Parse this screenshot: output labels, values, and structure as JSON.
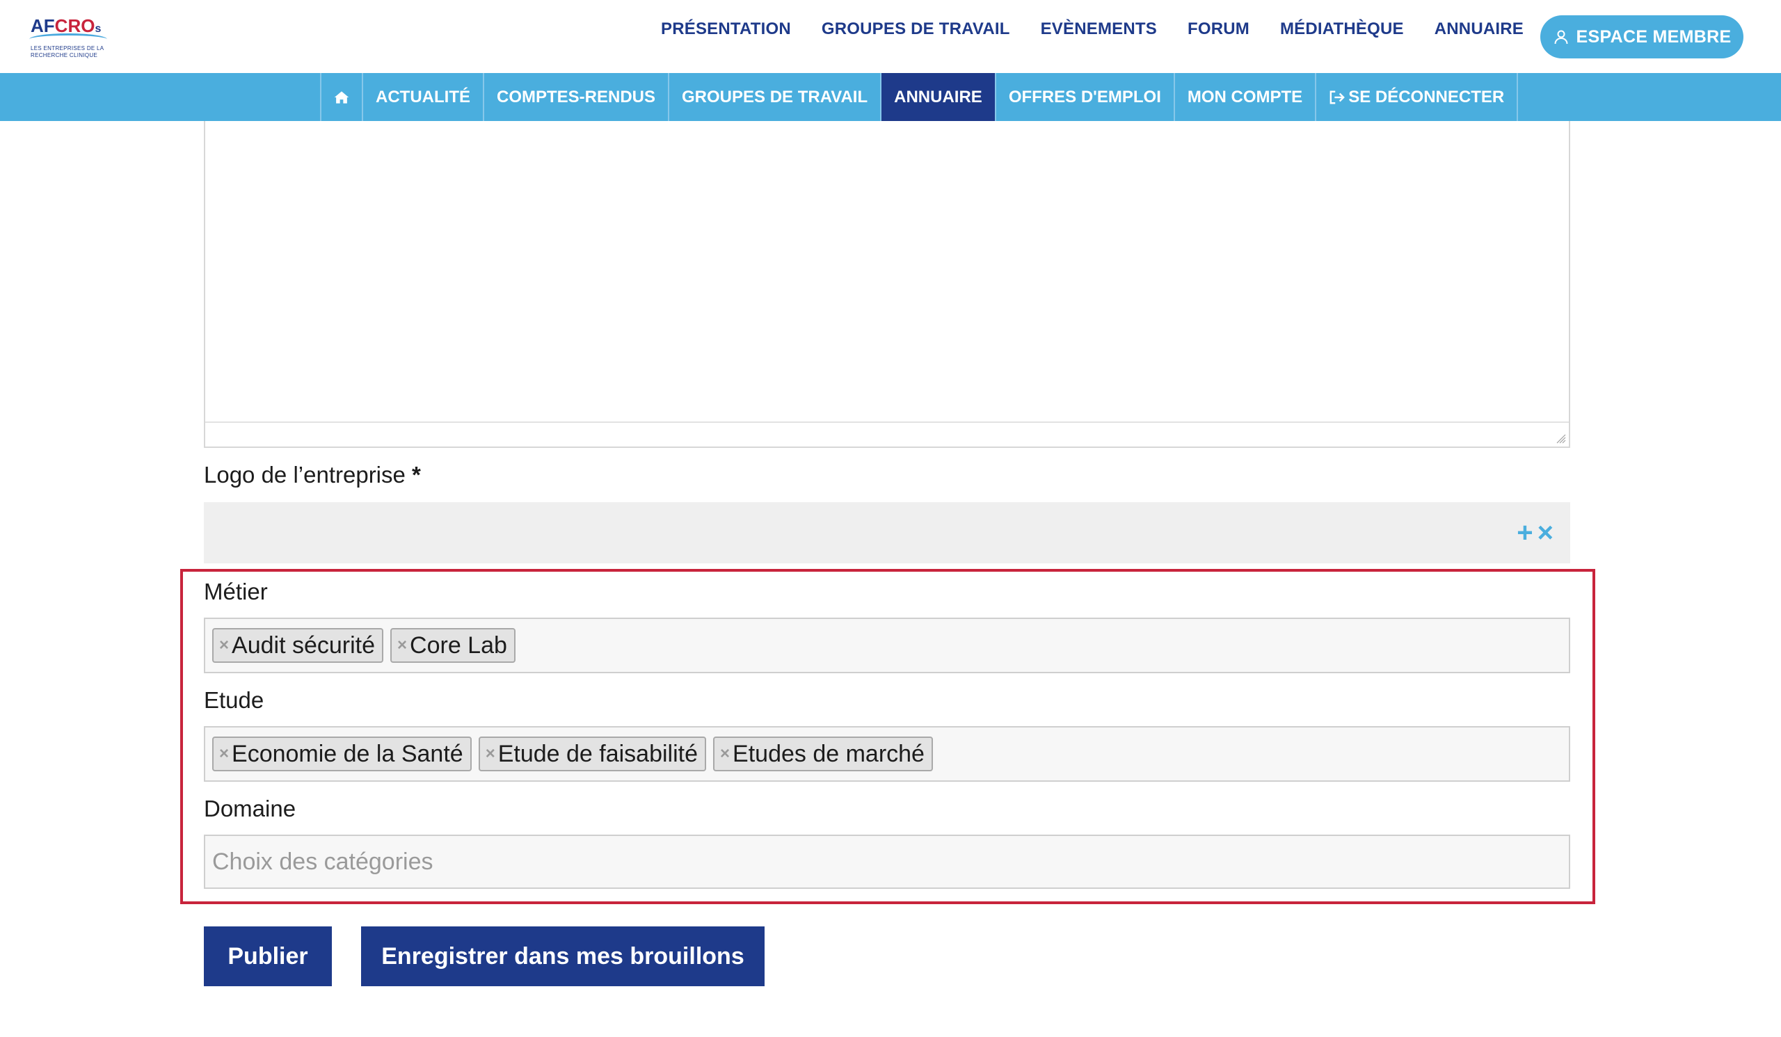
{
  "logo": {
    "name_af": "AF",
    "name_cro": "CRO",
    "name_s": "s",
    "tagline_1": "LES ENTREPRISES DE LA",
    "tagline_2": "RECHERCHE CLINIQUE"
  },
  "main_nav": [
    "PRÉSENTATION",
    "GROUPES DE TRAVAIL",
    "EVÈNEMENTS",
    "FORUM",
    "MÉDIATHÈQUE",
    "ANNUAIRE"
  ],
  "member_button": {
    "label": "ESPACE MEMBRE",
    "icon": "user-icon"
  },
  "sub_nav": {
    "home_icon": "home-icon",
    "items": [
      "ACTUALITÉ",
      "COMPTES-RENDUS",
      "GROUPES DE TRAVAIL",
      "ANNUAIRE",
      "OFFRES D'EMPLOI",
      "MON COMPTE",
      "SE DÉCONNECTER"
    ],
    "active": "ANNUAIRE",
    "logout_icon": "sign-out-icon"
  },
  "form": {
    "logo_field": {
      "label": "Logo de l’entreprise",
      "required_mark": "*",
      "add_icon": "plus-icon",
      "remove_icon": "close-icon"
    },
    "metier": {
      "label": "Métier",
      "tags": [
        "Audit sécurité",
        "Core Lab"
      ]
    },
    "etude": {
      "label": "Etude",
      "tags": [
        "Economie de la Santé",
        "Etude de faisabilité",
        "Etudes de marché"
      ]
    },
    "domaine": {
      "label": "Domaine",
      "placeholder": "Choix des catégories",
      "value": ""
    },
    "buttons": {
      "publish": "Publier",
      "draft": "Enregistrer dans mes brouillons"
    }
  },
  "colors": {
    "primary": "#1e3a8a",
    "accent": "#4aaede",
    "highlight": "#c8243c"
  }
}
